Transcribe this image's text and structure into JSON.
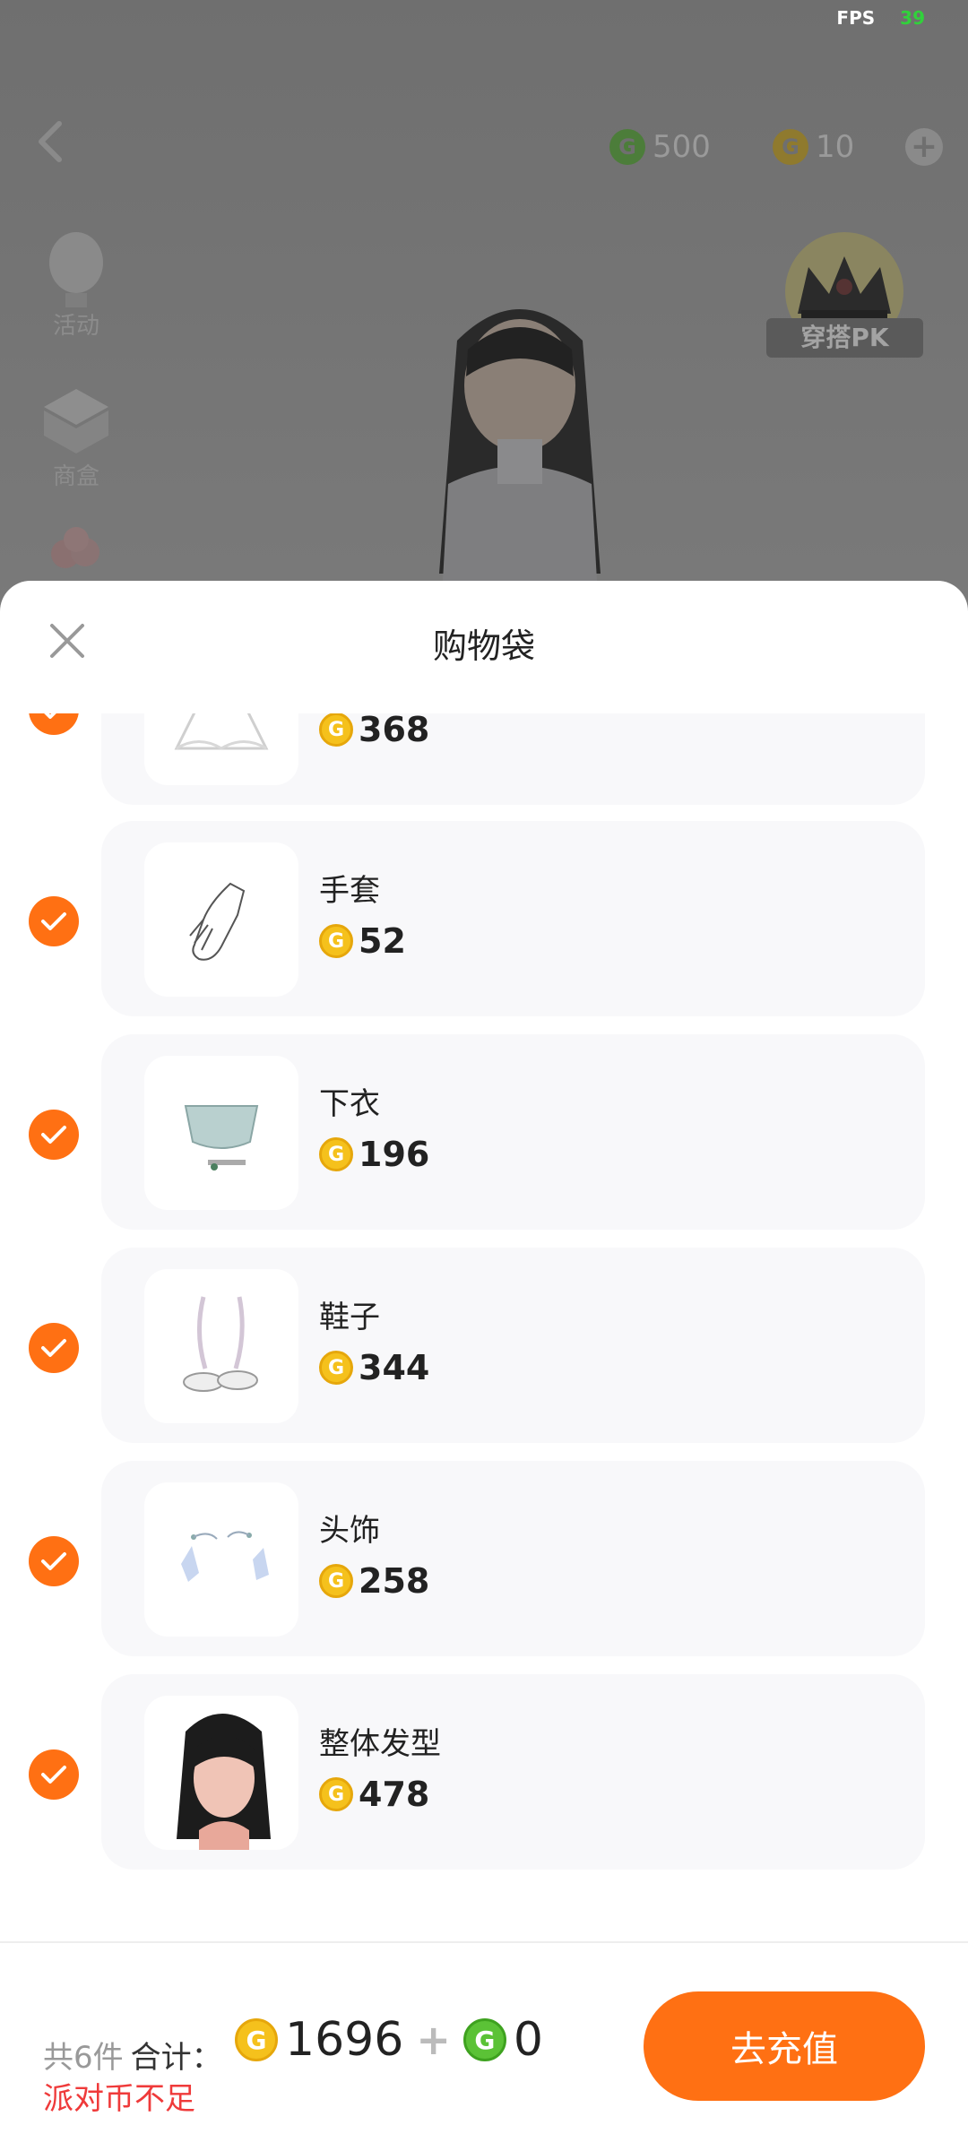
{
  "hud": {
    "fps_label": "FPS",
    "fps_value": "39",
    "currency_green": "500",
    "currency_yellow": "10",
    "side_items": [
      "活动",
      "商盒"
    ],
    "pk_label": "穿搭PK"
  },
  "sheet": {
    "title": "购物袋",
    "items": [
      {
        "name": "",
        "price": "368",
        "icon": "dress-icon"
      },
      {
        "name": "手套",
        "price": "52",
        "icon": "glove-icon"
      },
      {
        "name": "下衣",
        "price": "196",
        "icon": "skirt-icon"
      },
      {
        "name": "鞋子",
        "price": "344",
        "icon": "shoes-icon"
      },
      {
        "name": "头饰",
        "price": "258",
        "icon": "headpiece-icon"
      },
      {
        "name": "整体发型",
        "price": "478",
        "icon": "hairstyle-icon"
      }
    ]
  },
  "footer": {
    "count": "共6件",
    "total_label": "合计：",
    "coin_total": "1696",
    "plus": "+",
    "green_total": "0",
    "warning": "派对币不足",
    "button_label": "去充值"
  },
  "colors": {
    "accent": "#ff7013",
    "coin_gold": "#f5c11c",
    "coin_green": "#5bc236",
    "warning": "#ef3a3a"
  }
}
